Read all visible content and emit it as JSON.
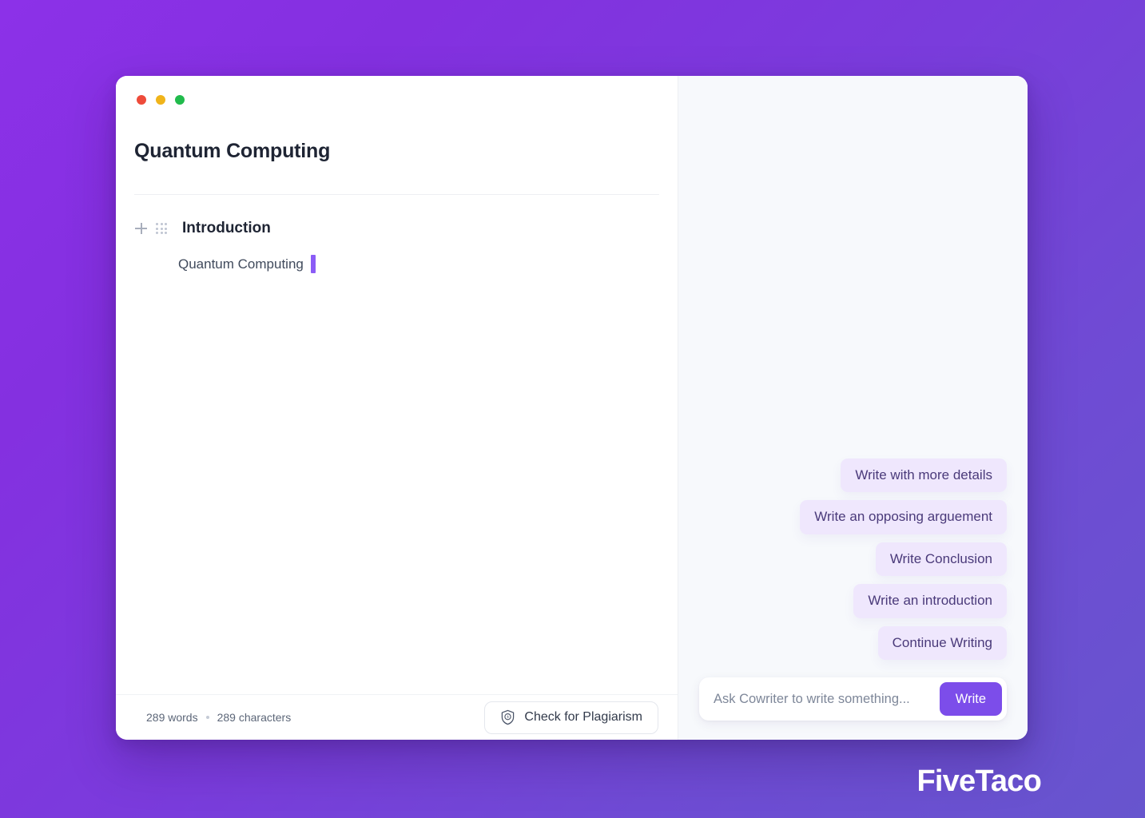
{
  "background": {
    "gradient_from": "#8C31E8",
    "gradient_to": "#6755CE"
  },
  "window": {
    "traffic_lights": {
      "close_color": "#EE4B3A",
      "minimize_color": "#F0B41A",
      "zoom_color": "#21BB4C"
    }
  },
  "editor": {
    "document_title": "Quantum Computing",
    "blocks": [
      {
        "heading": "Introduction",
        "paragraph": "Quantum Computing"
      }
    ],
    "footer": {
      "word_count": "289 words",
      "character_count": "289 characters",
      "plagiarism_button_label": "Check for Plagiarism"
    }
  },
  "assistant": {
    "panel_background": "#F7F9FC",
    "suggestions": [
      {
        "label": "Write with more details"
      },
      {
        "label": "Write an opposing arguement"
      },
      {
        "label": "Write Conclusion"
      },
      {
        "label": "Write an introduction"
      },
      {
        "label": "Continue Writing"
      }
    ],
    "composer": {
      "placeholder": "Ask Cowriter to write something...",
      "value": "",
      "submit_label": "Write",
      "accent_color": "#7C4DEA"
    }
  },
  "brand": {
    "name": "FiveTaco"
  }
}
